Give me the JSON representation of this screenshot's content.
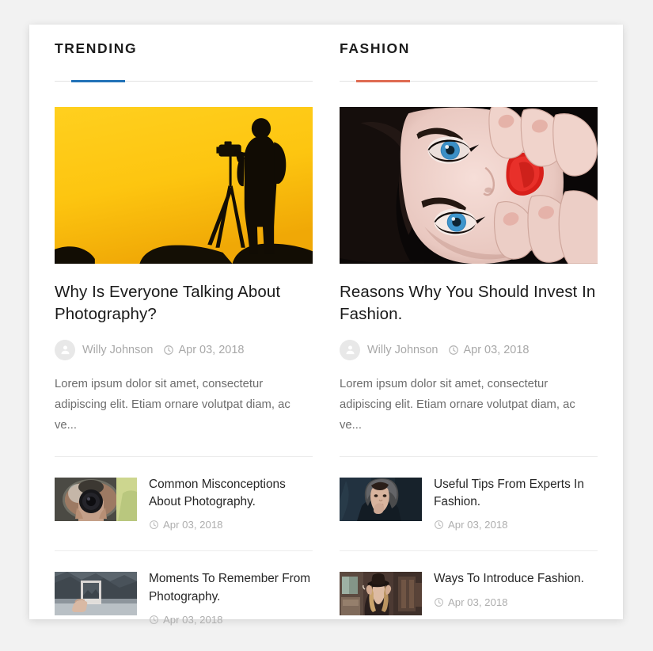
{
  "theme": {
    "page_background": "#f2f2f2",
    "card_background": "#ffffff",
    "trending_accent": "#2272b8",
    "fashion_accent": "#df6b52",
    "title_color": "#1a1a1a",
    "meta_color": "#a8a8a8",
    "excerpt_color": "#6d6d6d",
    "divider_color": "#ececec"
  },
  "columns": [
    {
      "id": "trending",
      "heading": "TRENDING",
      "accent_color": "#2272b8",
      "featured": {
        "image_name": "photographer-silhouette-tripod-yellow-sky",
        "title": "Why Is Everyone Talking About Photography?",
        "author": "Willy Johnson",
        "date": "Apr 03, 2018",
        "excerpt": "Lorem ipsum dolor sit amet, consectetur adipiscing elit. Etiam ornare volutpat diam, ac ve..."
      },
      "items": [
        {
          "image_name": "photographer-shooting-through-car-mirror",
          "title": "Common Misconceptions About Photography.",
          "date": "Apr 03, 2018"
        },
        {
          "image_name": "hand-holding-instant-photo-mountain",
          "title": "Moments To Remember From Photography.",
          "date": "Apr 03, 2018"
        }
      ]
    },
    {
      "id": "fashion",
      "heading": "FASHION",
      "accent_color": "#df6b52",
      "featured": {
        "image_name": "woman-portrait-blue-eyes-red-lips",
        "title": "Reasons Why You Should Invest In Fashion.",
        "author": "Willy Johnson",
        "date": "Apr 03, 2018",
        "excerpt": "Lorem ipsum dolor sit amet, consectetur adipiscing elit. Etiam ornare volutpat diam, ac ve..."
      },
      "items": [
        {
          "image_name": "woman-fur-hood-winter-coat",
          "title": "Useful Tips From Experts In Fashion.",
          "date": "Apr 03, 2018"
        },
        {
          "image_name": "woman-hat-vintage-interior",
          "title": "Ways To Introduce Fashion.",
          "date": "Apr 03, 2018"
        }
      ]
    }
  ],
  "icons": {
    "avatar": "user-avatar-icon",
    "clock": "clock-icon"
  }
}
